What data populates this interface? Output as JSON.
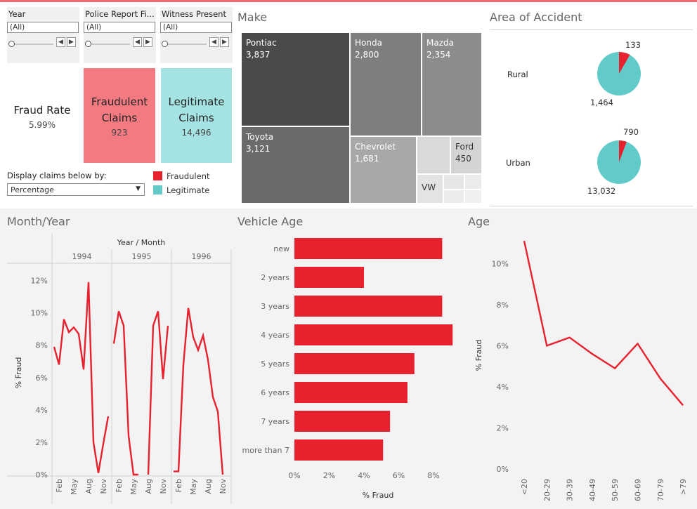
{
  "filters": [
    {
      "title": "Year",
      "value": "(All)"
    },
    {
      "title": "Police Report Fi...",
      "value": "(All)"
    },
    {
      "title": "Witness Present",
      "value": "(All)"
    }
  ],
  "kpis": {
    "fraud_rate": {
      "label": "Fraud Rate",
      "value": "5.99%"
    },
    "fraudulent": {
      "label": "Fraudulent Claims",
      "value": "923"
    },
    "legitimate": {
      "label": "Legitimate Claims",
      "value": "14,496"
    }
  },
  "display_by": {
    "label": "Display claims below by:",
    "value": "Percentage"
  },
  "legend": {
    "fraudulent": "Fraudulent",
    "legitimate": "Legitimate"
  },
  "colors": {
    "fraud": "#e8212f",
    "legit": "#62cbc9",
    "fraud_kpi": "#f47a82",
    "legit_kpi": "#a5e3e2"
  },
  "make": {
    "title": "Make",
    "tiles": [
      {
        "name": "Pontiac",
        "value": "3,837"
      },
      {
        "name": "Honda",
        "value": "2,800"
      },
      {
        "name": "Mazda",
        "value": "2,354"
      },
      {
        "name": "Toyota",
        "value": "3,121"
      },
      {
        "name": "Chevrolet",
        "value": "1,681"
      },
      {
        "name": "Ford",
        "value": "450"
      },
      {
        "name": "VW",
        "value": ""
      }
    ]
  },
  "area": {
    "title": "Area of Accident",
    "rows": [
      {
        "label": "Rural",
        "fraud": 133,
        "legit": 1464,
        "fraud_label": "133",
        "legit_label": "1,464"
      },
      {
        "label": "Urban",
        "fraud": 790,
        "legit": 13032,
        "fraud_label": "790",
        "legit_label": "13,032"
      }
    ]
  },
  "chart_data": [
    {
      "type": "line",
      "title": "Month/Year",
      "header": "Year / Month",
      "ylabel": "% Fraud",
      "ylim": [
        0,
        12.5
      ],
      "yticks": [
        "0%",
        "2%",
        "4%",
        "6%",
        "8%",
        "10%",
        "12%"
      ],
      "month_ticks": [
        "Feb",
        "May",
        "Aug",
        "Nov"
      ],
      "series": [
        {
          "year": "1994",
          "values": [
            7.9,
            6.8,
            9.6,
            8.8,
            9.1,
            8.7,
            6.5,
            11.9,
            2.0,
            0.1,
            1.9,
            3.6
          ]
        },
        {
          "year": "1995",
          "values": [
            8.1,
            10.1,
            9.2,
            2.4,
            0.0,
            0.0,
            null,
            0.0,
            9.2,
            10.1,
            5.9,
            9.2
          ]
        },
        {
          "year": "1996",
          "values": [
            0.2,
            0.2,
            6.8,
            10.3,
            8.5,
            7.7,
            8.6,
            7.1,
            4.8,
            3.9,
            0.0
          ]
        }
      ]
    },
    {
      "type": "bar",
      "title": "Vehicle Age",
      "xlabel": "% Fraud",
      "xlim": [
        0,
        9
      ],
      "xticks": [
        "0%",
        "2%",
        "4%",
        "6%",
        "8%"
      ],
      "categories": [
        "new",
        "2 years",
        "3 years",
        "4 years",
        "5 years",
        "6 years",
        "7 years",
        "more than 7"
      ],
      "values": [
        8.5,
        4.0,
        8.5,
        9.1,
        6.9,
        6.5,
        5.5,
        5.1
      ]
    },
    {
      "type": "line",
      "title": "Age",
      "ylabel": "% Fraud",
      "ylim": [
        0,
        11.5
      ],
      "yticks": [
        "0%",
        "2%",
        "4%",
        "6%",
        "8%",
        "10%"
      ],
      "categories": [
        "<20",
        "20-29",
        "30-39",
        "40-49",
        "50-59",
        "60-69",
        "70-79",
        ">79"
      ],
      "values": [
        11.1,
        6.0,
        6.4,
        5.6,
        4.9,
        6.1,
        4.4,
        3.1
      ]
    }
  ]
}
